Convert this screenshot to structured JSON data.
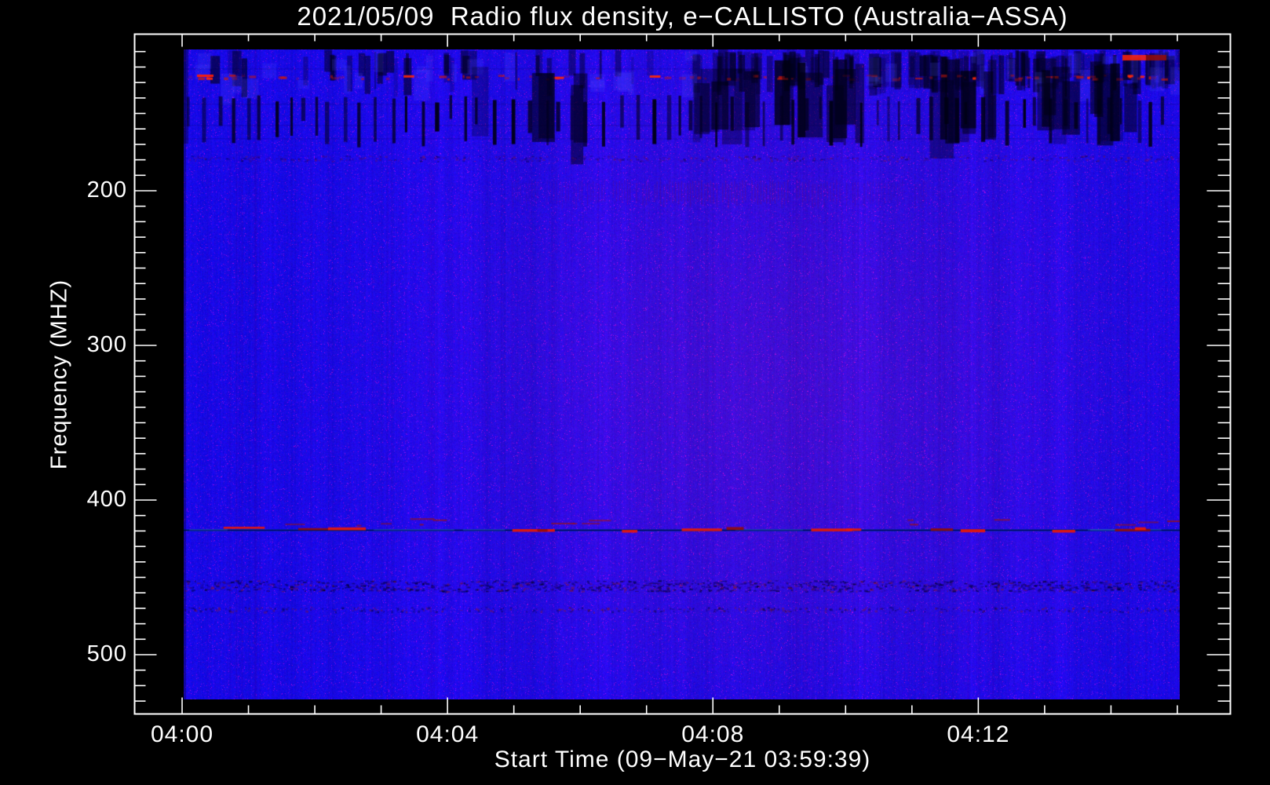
{
  "chart_data": {
    "type": "heatmap",
    "subtype": "radio-spectrogram",
    "title": "2021/05/09  Radio flux density, e−CALLISTO (Australia−ASSA)",
    "xlabel": "Start Time (09−May−21 03:59:39)",
    "ylabel": "Frequency (MHZ)",
    "station": "Australia-ASSA",
    "date": "2021/05/09",
    "start_time": "03:59:39",
    "x_ticks": [
      {
        "label": "04:00",
        "minute": 0
      },
      {
        "label": "04:04",
        "minute": 4
      },
      {
        "label": "04:08",
        "minute": 8
      },
      {
        "label": "04:12",
        "minute": 12
      }
    ],
    "x_minor_tick_every_minutes": 1,
    "x_minor_tick_minutes": [
      0,
      1,
      2,
      3,
      4,
      5,
      6,
      7,
      8,
      9,
      10,
      11,
      12,
      13,
      14,
      15
    ],
    "y_ticks": [
      {
        "label": "200",
        "mhz": 200
      },
      {
        "label": "300",
        "mhz": 300
      },
      {
        "label": "400",
        "mhz": 400
      },
      {
        "label": "500",
        "mhz": 500
      }
    ],
    "y_minor_tick_every_mhz": 10,
    "y_axis_inverted": true,
    "freq_display_range_mhz": [
      109,
      529
    ],
    "time_display_span_minutes": 15.4,
    "grid": false,
    "legend": "none",
    "colors": {
      "background": "#000000",
      "axes": "#ffffff",
      "text": "#ffffff",
      "base_blue": "#1d10ee",
      "center_purple_tint": "#4a18d2",
      "rfi_dark": "#000016",
      "burst_red_bright": "#ff2808",
      "burst_red_dark": "#960c04",
      "fixed_line_blue": "#0028a0"
    },
    "features": [
      {
        "name": "broadband-rfi-streaks",
        "mhz": [
          109,
          138
        ],
        "desc": "blotchy dark vertical interference streaks along top of band, denser to the right, with sparse red specks"
      },
      {
        "name": "red-rfi-row",
        "mhz": [
          125,
          129
        ],
        "desc": "row of short red dashes; bright red segment at far left and dark-red streak at top right"
      },
      {
        "name": "pulse-barcode-row",
        "mhz": [
          138,
          167
        ],
        "desc": "quasi-periodic dark vertical dashes (~1 per 15 s) across full width"
      },
      {
        "name": "speckle-row",
        "mhz": [
          177,
          181
        ],
        "desc": "thin row of tiny dark speckles across full width"
      },
      {
        "name": "comb-band",
        "mhz": [
          193,
          209
        ],
        "time_frac": [
          0.33,
          0.75
        ],
        "desc": "faint dark-red vertical comb, strongest near mid-plot"
      },
      {
        "name": "fixed-frequency-line",
        "mhz": 420,
        "desc": "continuous dark-blue horizontal line with scattered red RFI bursts",
        "bursts_frac": [
          0.04,
          0.115,
          0.145,
          0.33,
          0.355,
          0.44,
          0.5,
          0.545,
          0.63,
          0.665,
          0.75,
          0.78,
          0.872,
          0.935,
          0.955
        ]
      },
      {
        "name": "noise-band",
        "mhz": [
          452,
          459
        ],
        "desc": "dense speckled band of dark and red dots"
      },
      {
        "name": "noise-band-2",
        "mhz": [
          469,
          472
        ],
        "desc": "sparser row of short dark/red ticks"
      },
      {
        "name": "purple-cast",
        "desc": "subtle magenta/purple cast near plot centre",
        "center_frac": [
          0.6,
          0.52
        ]
      }
    ]
  }
}
